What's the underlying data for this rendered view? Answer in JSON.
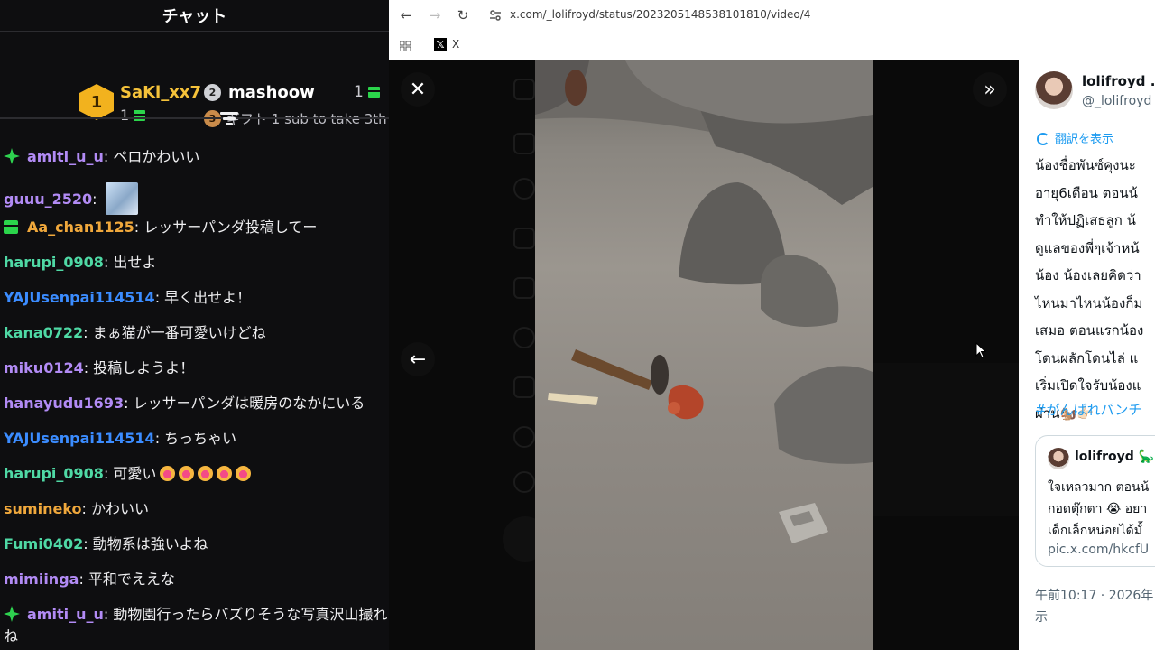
{
  "chat": {
    "title": "チャット",
    "leaderboard": {
      "first": {
        "rank": "1",
        "name": "SaKi_xx7",
        "count": "1"
      },
      "second": {
        "rank": "2",
        "name": "mashoow",
        "count": "1"
      },
      "third": {
        "rank": "3",
        "text": "ギフト 1 sub to take 3th"
      }
    },
    "messages": [
      {
        "user": "amiti_u_u",
        "sep": ": ",
        "text": "ペロかわいい",
        "color": "#b28bf5",
        "badge": "sparkle"
      },
      {
        "user": "guuu_2520",
        "sep": ": ",
        "text": "",
        "color": "#b28bf5",
        "emote": "image"
      },
      {
        "user": "Aa_chan1125",
        "sep": ": ",
        "text": "レッサーパンダ投稿してー",
        "color": "#f0a83c",
        "badge": "gift"
      },
      {
        "user": "harupi_0908",
        "sep": ": ",
        "text": "出せよ",
        "color": "#4fd9a5"
      },
      {
        "user": "YAJUsenpai114514",
        "sep": ": ",
        "text": "早く出せよ！",
        "color": "#3b8cff"
      },
      {
        "user": "kana0722",
        "sep": ": ",
        "text": "まぁ猫が一番可愛いけどね",
        "color": "#4fd9a5"
      },
      {
        "user": "miku0124",
        "sep": ": ",
        "text": "投稿しようよ！",
        "color": "#b28bf5"
      },
      {
        "user": "hanayudu1693",
        "sep": ": ",
        "text": "レッサーパンダは暖房のなかにいる",
        "color": "#b28bf5"
      },
      {
        "user": "YAJUsenpai114514",
        "sep": ": ",
        "text": "ちっちゃい",
        "color": "#3b8cff"
      },
      {
        "user": "harupi_0908",
        "sep": ": ",
        "text": "可愛い",
        "color": "#4fd9a5",
        "emotes": 5
      },
      {
        "user": "sumineko",
        "sep": ": ",
        "text": "かわいい",
        "color": "#f0a83c"
      },
      {
        "user": "Fumi0402",
        "sep": ": ",
        "text": "動物系は強いよね",
        "color": "#4fd9a5"
      },
      {
        "user": "mimiinga",
        "sep": ": ",
        "text": "平和でええな",
        "color": "#b28bf5"
      },
      {
        "user": "amiti_u_u",
        "sep": ": ",
        "text": "動物園行ったらバズりそうな写真沢山撮れ",
        "color": "#b28bf5",
        "badge": "sparkle"
      }
    ],
    "overflow_text": "ね"
  },
  "browser": {
    "url": "x.com/_lolifroyd/status/2023205148538101810/video/4",
    "bookmark_label": "X",
    "bookmark_icon": "𝕏"
  },
  "viewer": {
    "close_label": "✕",
    "back_label": "←",
    "expand_label": "»"
  },
  "tweet": {
    "author_name": "lolifroyd ..",
    "author_handle": "@_lolifroyd",
    "translate_label": "翻訳を表示",
    "lines": [
      "น้องชื่อพันซ์คุงนะ",
      "อายุ6เดือน ตอนน้",
      "ทำให้ปฏิเสธลูก น้",
      "ดูแลของพี่ๆเจ้าหน้",
      "น้อง น้องเลยคิดว่า",
      "ไหนมาไหนน้องก็ม",
      "เสมอ ตอนแรกน้อง",
      "โดนผลักโดนไล่ แ",
      "เริ่มเปิดใจรับน้องแ",
      "ผ่าน🐿️👉🏻"
    ],
    "hashtag": "#がんばれパンチ",
    "quote": {
      "author": "lolifroyd 🦕",
      "lines": [
        "ใจเหลวมาก ตอนน้",
        "กอดตุ๊กตา 😭 อยา",
        "เด็กเล็กหน่อยได้มั้",
        "pic.x.com/hkcfU"
      ]
    },
    "timestamp": "午前10:17 · 2026年",
    "timestamp_cont": "示"
  },
  "colors": {
    "chat_bg": "#0e0e10",
    "link_blue": "#1d9bf0",
    "gold": "#f2b21e",
    "gift_green": "#2bd44b"
  }
}
